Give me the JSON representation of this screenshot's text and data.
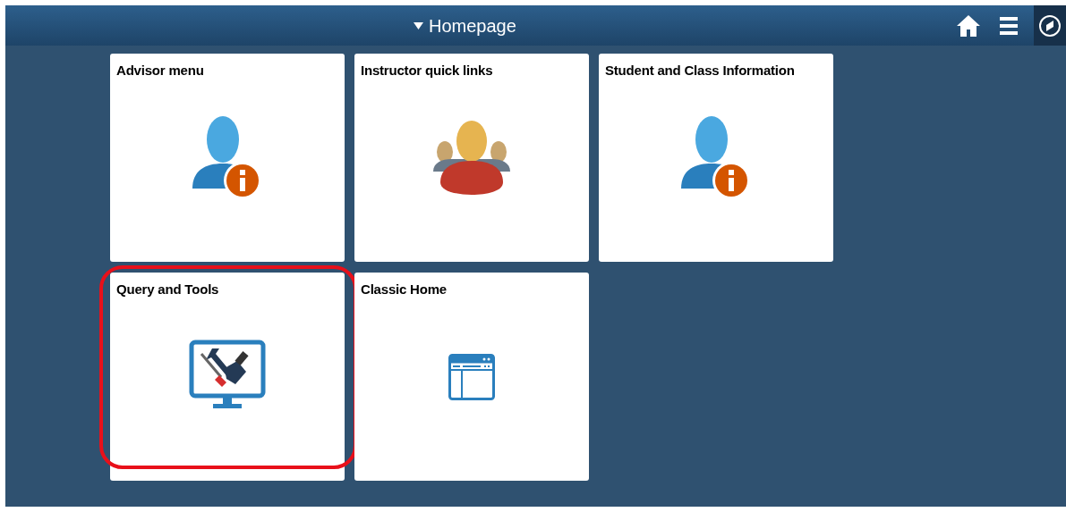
{
  "header": {
    "title": "Homepage"
  },
  "tiles": [
    {
      "title": "Advisor menu",
      "kind": "person-info",
      "highlighted": false
    },
    {
      "title": "Instructor quick links",
      "kind": "group",
      "highlighted": false
    },
    {
      "title": "Student and Class Information",
      "kind": "person-info",
      "highlighted": false
    },
    {
      "title": "Query and Tools",
      "kind": "tools",
      "highlighted": true
    },
    {
      "title": "Classic Home",
      "kind": "classic",
      "highlighted": false
    }
  ]
}
